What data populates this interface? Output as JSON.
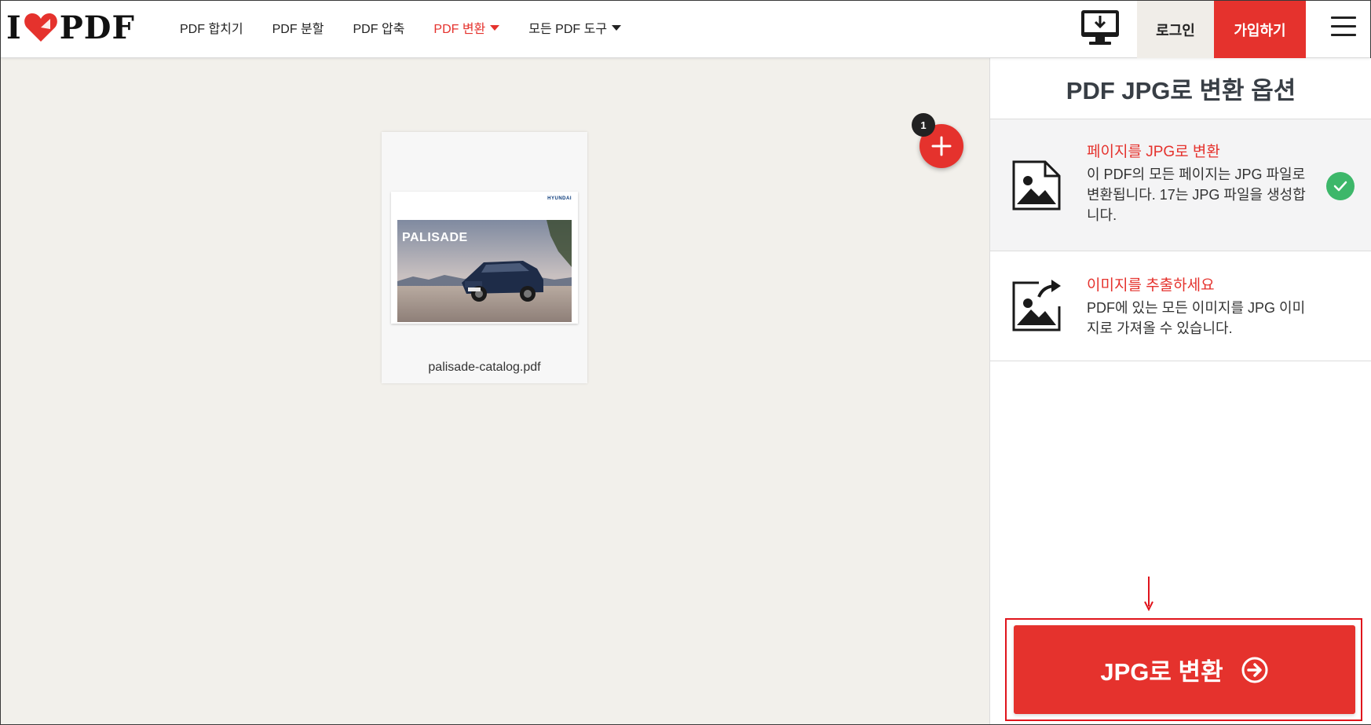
{
  "header": {
    "logo": {
      "left": "I",
      "right": "PDF",
      "brand_color": "#e5322d"
    },
    "nav": [
      {
        "label": "PDF 합치기",
        "active": false,
        "dropdown": false
      },
      {
        "label": "PDF 분할",
        "active": false,
        "dropdown": false
      },
      {
        "label": "PDF 압축",
        "active": false,
        "dropdown": false
      },
      {
        "label": "PDF 변환",
        "active": true,
        "dropdown": true
      },
      {
        "label": "모든 PDF 도구",
        "active": false,
        "dropdown": true
      }
    ],
    "desktop_icon": "desktop-download-icon",
    "login_label": "로그인",
    "signup_label": "가입하기",
    "menu_icon": "hamburger-menu-icon"
  },
  "workspace": {
    "file": {
      "name": "palisade-catalog.pdf",
      "thumbnail_title": "PALISADE",
      "thumbnail_brand": "HYUNDAI"
    },
    "add_badge_count": "1",
    "add_icon": "plus-icon"
  },
  "sidebar": {
    "title": "PDF JPG로 변환 옵션",
    "options": [
      {
        "title": "페이지를 JPG로 변환",
        "description": "이 PDF의 모든 페이지는 JPG 파일로 변환됩니다. 17는 JPG 파일을 생성합니다.",
        "selected": true,
        "icon": "image-document-icon"
      },
      {
        "title": "이미지를 추출하세요",
        "description": "PDF에 있는 모든 이미지를 JPG 이미지로 가져올 수 있습니다.",
        "selected": false,
        "icon": "image-extract-icon"
      }
    ],
    "convert_label": "JPG로 변환",
    "convert_icon": "arrow-right-circle-icon"
  },
  "colors": {
    "accent": "#e5322d",
    "check": "#3db76a",
    "workspace_bg": "#f2f0eb",
    "annotation": "#e0141c"
  }
}
